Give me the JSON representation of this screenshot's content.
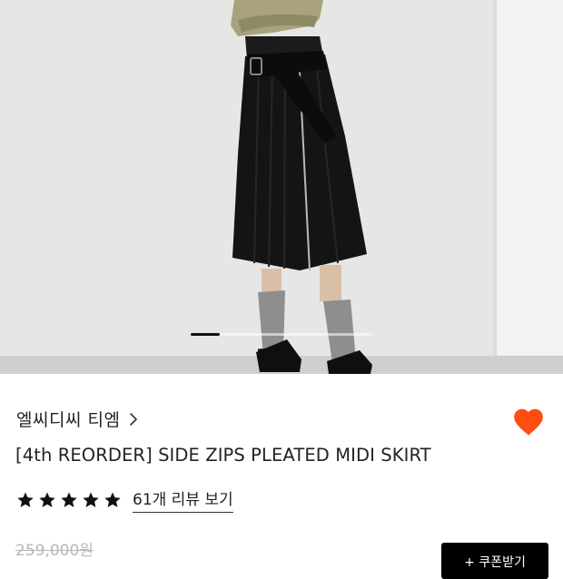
{
  "product": {
    "brand": "엘씨디씨 티엠",
    "title": "[4th REORDER] SIDE ZIPS PLEATED MIDI SKIRT",
    "rating_stars": 5,
    "reviews_label": "61개 리뷰 보기",
    "original_price": "259,000원",
    "wishlisted": true
  },
  "gallery": {
    "current_index": 1
  },
  "actions": {
    "coupon_label": "+ 쿠폰받기"
  },
  "colors": {
    "heart": "#ff4e12",
    "star": "#111111",
    "button_bg": "#000000",
    "price_strike": "#b8b8b8"
  },
  "icons": [
    "chevron-right-icon",
    "heart-icon",
    "star-icon"
  ]
}
